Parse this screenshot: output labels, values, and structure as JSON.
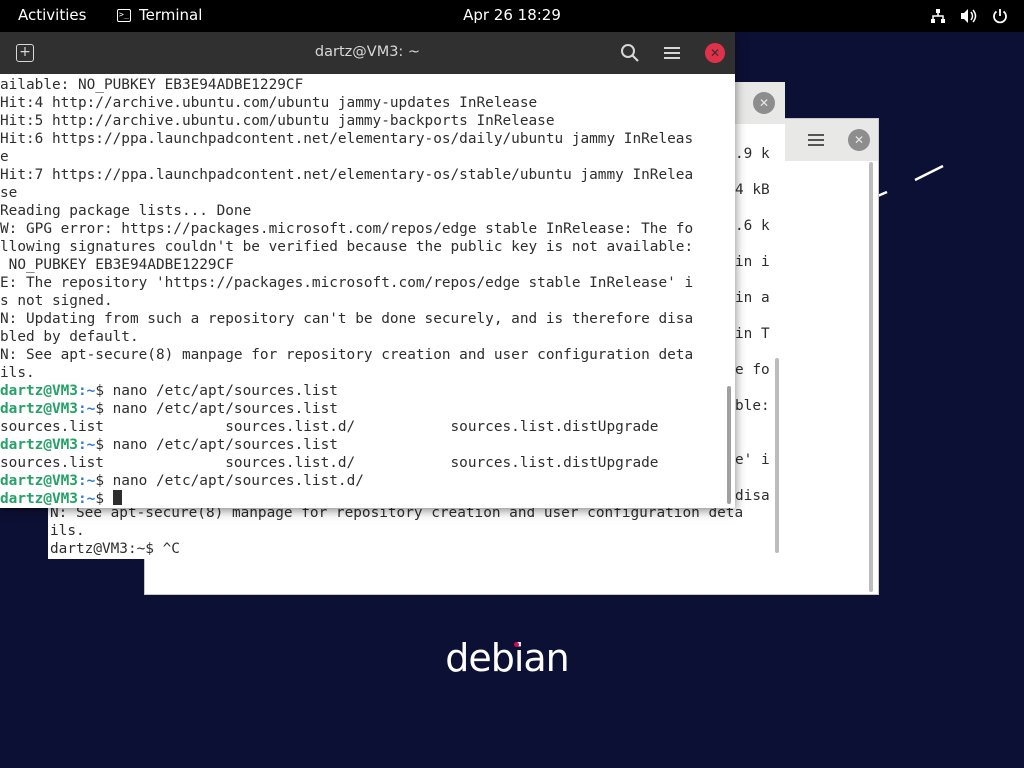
{
  "topbar": {
    "activities": "Activities",
    "app_name": "Terminal",
    "clock": "Apr 26  18:29"
  },
  "icons": {
    "network": "network-icon",
    "volume": "volume-icon",
    "power": "power-icon"
  },
  "desktop": {
    "logo_text": "debian"
  },
  "main_terminal": {
    "title": "dartz@VM3: ~",
    "lines": [
      {
        "t": "ailable: NO_PUBKEY EB3E94ADBE1229CF"
      },
      {
        "t": "Hit:4 http://archive.ubuntu.com/ubuntu jammy-updates InRelease"
      },
      {
        "t": "Hit:5 http://archive.ubuntu.com/ubuntu jammy-backports InRelease"
      },
      {
        "t": "Hit:6 https://ppa.launchpadcontent.net/elementary-os/daily/ubuntu jammy InReleas"
      },
      {
        "t": "e"
      },
      {
        "t": "Hit:7 https://ppa.launchpadcontent.net/elementary-os/stable/ubuntu jammy InRelea"
      },
      {
        "t": "se"
      },
      {
        "t": "Reading package lists... Done"
      },
      {
        "t": "W: GPG error: https://packages.microsoft.com/repos/edge stable InRelease: The fo"
      },
      {
        "t": "llowing signatures couldn't be verified because the public key is not available:"
      },
      {
        "t": " NO_PUBKEY EB3E94ADBE1229CF"
      },
      {
        "t": "E: The repository 'https://packages.microsoft.com/repos/edge stable InRelease' i"
      },
      {
        "t": "s not signed."
      },
      {
        "t": "N: Updating from such a repository can't be done securely, and is therefore disa"
      },
      {
        "t": "bled by default."
      },
      {
        "t": "N: See apt-secure(8) manpage for repository creation and user configuration deta"
      },
      {
        "t": "ils."
      },
      {
        "u": "dartz@VM3",
        "p": ":~",
        "t": "$ nano /etc/apt/sources.list"
      },
      {
        "u": "dartz@VM3",
        "p": ":~",
        "t": "$ nano /etc/apt/sources.list"
      },
      {
        "t": "sources.list              sources.list.d/           sources.list.distUpgrade"
      },
      {
        "u": "dartz@VM3",
        "p": ":~",
        "t": "$ nano /etc/apt/sources.list"
      },
      {
        "t": "sources.list              sources.list.d/           sources.list.distUpgrade"
      },
      {
        "u": "dartz@VM3",
        "p": ":~",
        "t": "$ nano /etc/apt/sources.list.d/"
      },
      {
        "u": "dartz@VM3",
        "p": ":~",
        "t": "$ ",
        "cursor": true
      }
    ]
  },
  "back_terminal": {
    "right_fragments": [
      ".9 k",
      "4 kB",
      ".6 k",
      "in i",
      "in a",
      "in T",
      "e fo",
      "ble:",
      "e' i",
      "disa"
    ],
    "tail_lines": [
      "N: See apt-secure(8) manpage for repository creation and user configuration deta",
      "ils.",
      "dartz@VM3:~$ ^C"
    ]
  }
}
